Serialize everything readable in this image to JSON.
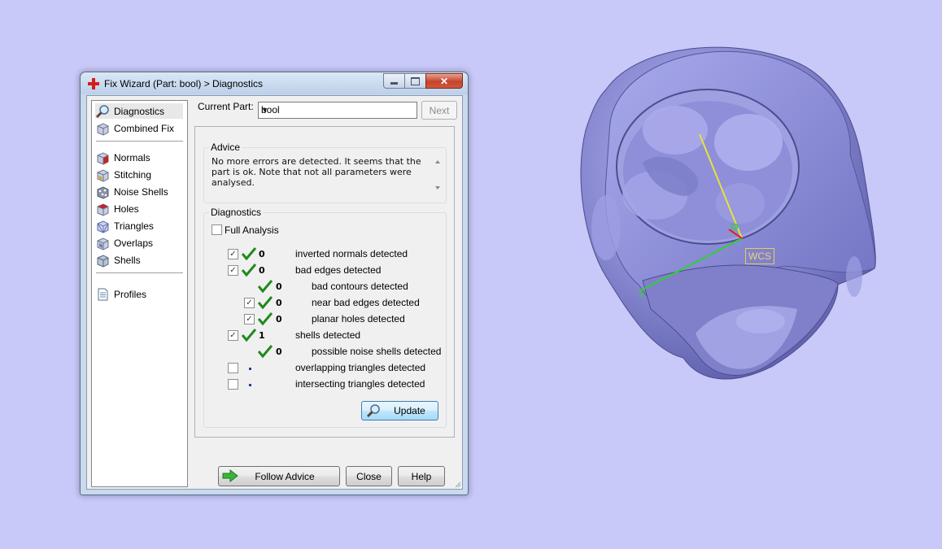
{
  "window": {
    "title": "Fix Wizard (Part: bool) > Diagnostics",
    "caption": {
      "minimize": "minimize",
      "maximize": "maximize",
      "close": "✕"
    }
  },
  "nav": {
    "items": [
      {
        "label": "Diagnostics",
        "icon": "magnifier-icon"
      },
      {
        "label": "Combined Fix",
        "icon": "cube-combined-icon"
      },
      {
        "label": "Normals",
        "icon": "cube-normals-icon"
      },
      {
        "label": "Stitching",
        "icon": "cube-stitching-icon"
      },
      {
        "label": "Noise Shells",
        "icon": "cube-noise-icon"
      },
      {
        "label": "Holes",
        "icon": "cube-holes-icon"
      },
      {
        "label": "Triangles",
        "icon": "cube-triangles-icon"
      },
      {
        "label": "Overlaps",
        "icon": "cube-overlaps-icon"
      },
      {
        "label": "Shells",
        "icon": "cube-shells-icon"
      },
      {
        "label": "Profiles",
        "icon": "document-icon"
      }
    ]
  },
  "current_part": {
    "label": "Current Part:",
    "value": "bool"
  },
  "next_label": "Next",
  "advice": {
    "title": "Advice",
    "text": "No more errors are detected. It seems that the part is ok. Note that not all parameters were analysed."
  },
  "diagnostics": {
    "title": "Diagnostics",
    "full_analysis_label": "Full Analysis",
    "rows": [
      {
        "checkbox": true,
        "checked": true,
        "status": "ok",
        "count": "0",
        "text": "inverted normals detected",
        "indent": 0
      },
      {
        "checkbox": true,
        "checked": true,
        "status": "ok",
        "count": "0",
        "text": "bad edges detected",
        "indent": 0
      },
      {
        "checkbox": false,
        "checked": false,
        "status": "ok",
        "count": "0",
        "text": "bad contours detected",
        "indent": 1
      },
      {
        "checkbox": true,
        "checked": true,
        "status": "ok",
        "count": "0",
        "text": "near bad edges detected",
        "indent": 1
      },
      {
        "checkbox": true,
        "checked": true,
        "status": "ok",
        "count": "0",
        "text": "planar holes detected",
        "indent": 1
      },
      {
        "checkbox": true,
        "checked": true,
        "status": "ok",
        "count": "1",
        "text": "shells detected",
        "indent": 0
      },
      {
        "checkbox": false,
        "checked": false,
        "status": "ok",
        "count": "0",
        "text": "possible noise shells detected",
        "indent": 1
      },
      {
        "checkbox": true,
        "checked": false,
        "status": "pending",
        "count": "",
        "text": "overlapping triangles detected",
        "indent": 0
      },
      {
        "checkbox": true,
        "checked": false,
        "status": "pending",
        "count": "",
        "text": "intersecting triangles detected",
        "indent": 0
      }
    ],
    "update_label": "Update"
  },
  "footer": {
    "follow_advice_label": "Follow Advice",
    "close_label": "Close",
    "help_label": "Help"
  },
  "viewport": {
    "wcs_label": "WCS"
  },
  "colors": {
    "background": "#c8c8f9",
    "model": "#8b8cd6",
    "check_green": "#1f8a1a",
    "axis_yellow": "#e8e23a",
    "axis_green": "#2fd12f",
    "axis_red": "#e02020"
  }
}
